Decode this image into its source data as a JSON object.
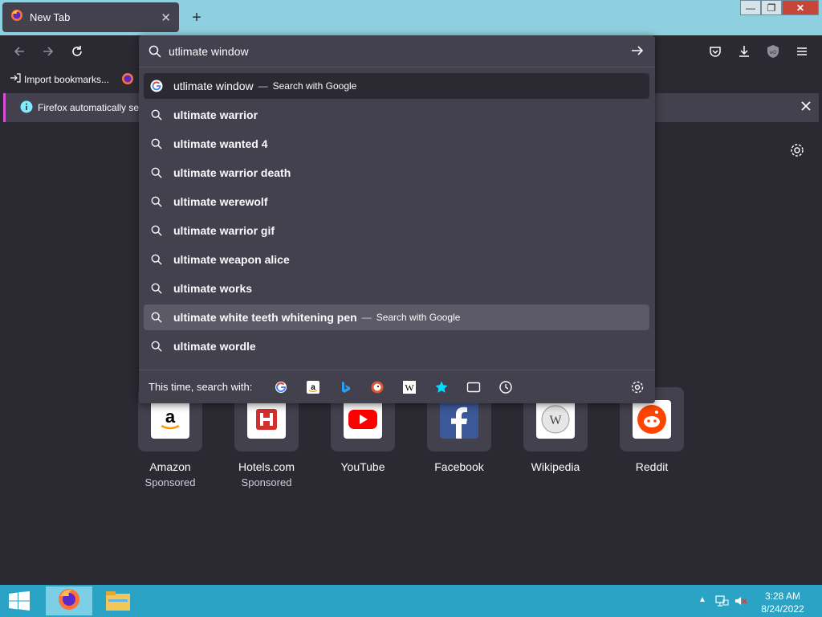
{
  "tab": {
    "title": "New Tab",
    "close": "✕",
    "new_tab": "+"
  },
  "window_controls": {
    "minimize": "—",
    "maximize": "❐",
    "close": "✕"
  },
  "bookmarks": {
    "import_label": "Import bookmarks..."
  },
  "notification": {
    "text": "Firefox automatically ser"
  },
  "urlbar": {
    "value": "utlimate window",
    "action_label": "Search with Google",
    "suggestions": [
      {
        "typed": "utlimate window",
        "rest": "",
        "action": true,
        "engine": "google"
      },
      {
        "typed": "ultimate w",
        "rest": "arrior"
      },
      {
        "typed": "ultimate w",
        "rest": "anted 4"
      },
      {
        "typed": "ultimate w",
        "rest": "arrior death"
      },
      {
        "typed": "ultimate w",
        "rest": "erewolf"
      },
      {
        "typed": "ultimate w",
        "rest": "arrior gif"
      },
      {
        "typed": "ultimate w",
        "rest": "eapon alice"
      },
      {
        "typed": "ultimate w",
        "rest": "orks"
      },
      {
        "typed": "ultimate w",
        "rest": "hite teeth whitening pen",
        "action": true
      },
      {
        "typed": "ultimate w",
        "rest": "ordle"
      }
    ],
    "engines_label": "This time, search with:",
    "engines": [
      "google",
      "amazon",
      "bing",
      "duckduckgo",
      "wikipedia",
      "bookmarks",
      "tabs",
      "history"
    ]
  },
  "top_sites": [
    {
      "name": "Amazon",
      "sub": "Sponsored",
      "icon": "amazon"
    },
    {
      "name": "Hotels.com",
      "sub": "Sponsored",
      "icon": "hotels"
    },
    {
      "name": "YouTube",
      "sub": "",
      "icon": "youtube"
    },
    {
      "name": "Facebook",
      "sub": "",
      "icon": "facebook"
    },
    {
      "name": "Wikipedia",
      "sub": "",
      "icon": "wikipedia"
    },
    {
      "name": "Reddit",
      "sub": "",
      "icon": "reddit"
    }
  ],
  "taskbar": {
    "time": "3:28 AM",
    "date": "8/24/2022"
  },
  "colors": {
    "accent": "#d84ed6",
    "toolbar": "#2b2a33",
    "panel": "#42414d",
    "taskbar": "#2aa3c4"
  }
}
